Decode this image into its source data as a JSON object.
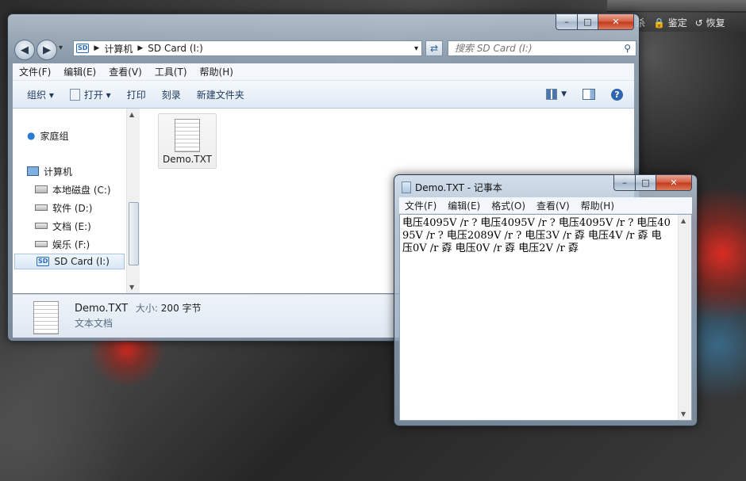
{
  "background_window": {
    "toolbar": [
      "杀",
      "鉴定",
      "恢复"
    ]
  },
  "explorer": {
    "caption_buttons": {
      "min": "–",
      "max": "□",
      "close": "✕"
    },
    "nav": {
      "back": "◀",
      "forward": "▶",
      "history": "▾"
    },
    "breadcrumb": [
      "计算机",
      "SD Card (I:)"
    ],
    "address_dropdown": "▾",
    "search_placeholder": "搜索 SD Card (I:)",
    "menu": [
      "文件(F)",
      "编辑(E)",
      "查看(V)",
      "工具(T)",
      "帮助(H)"
    ],
    "commands": [
      "组织 ▾",
      "打开 ▾",
      "打印",
      "刻录",
      "新建文件夹"
    ],
    "nav_pane": {
      "homegroup": "家庭组",
      "computer": "计算机",
      "drives": [
        "本地磁盘 (C:)",
        "软件 (D:)",
        "文档 (E:)",
        "娱乐 (F:)",
        "SD Card (I:)"
      ]
    },
    "files": [
      {
        "name": "Demo.TXT"
      }
    ],
    "details": {
      "name": "Demo.TXT",
      "size_label": "大小:",
      "size_value": "200 字节",
      "type": "文本文档"
    }
  },
  "notepad": {
    "title": "Demo.TXT - 记事本",
    "caption_buttons": {
      "min": "–",
      "max": "□",
      "close": "✕"
    },
    "menu": [
      "文件(F)",
      "编辑(E)",
      "格式(O)",
      "查看(V)",
      "帮助(H)"
    ],
    "content": "电压4095V /r ?     电压4095V /r ?     电压4095V /r ?     电压4095V /r ?     电压2089V /r ?     电压3V /r  孬     电压4V /r  孬     电压0V /r  孬     电压0V /r  孬     电压2V /r  孬"
  }
}
